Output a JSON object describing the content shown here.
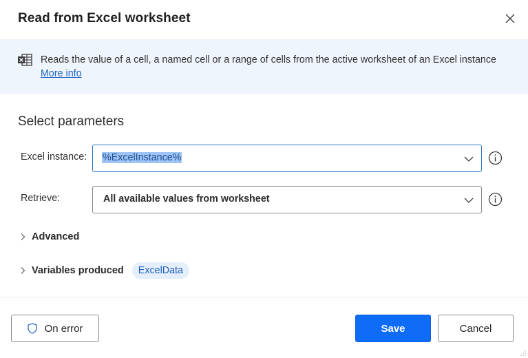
{
  "dialog": {
    "title": "Read from Excel worksheet",
    "close_icon": "close-icon"
  },
  "info": {
    "icon": "excel-icon",
    "description": "Reads the value of a cell, a named cell or a range of cells from the active worksheet of an Excel instance",
    "more_info_label": "More info"
  },
  "parameters": {
    "heading": "Select parameters",
    "fields": [
      {
        "label": "Excel instance:",
        "value": "%ExcelInstance%",
        "text_selected": true,
        "focused": true
      },
      {
        "label": "Retrieve:",
        "value": "All available values from worksheet",
        "text_selected": false,
        "focused": false
      }
    ]
  },
  "expanders": {
    "advanced_label": "Advanced",
    "variables_label": "Variables produced",
    "variables": [
      "ExcelData"
    ]
  },
  "footer": {
    "on_error_label": "On error",
    "save_label": "Save",
    "cancel_label": "Cancel"
  },
  "colors": {
    "primary": "#0f6cf7",
    "banner_bg": "#eff5fc",
    "link": "#1f63c3",
    "chip_bg": "#e5eefb",
    "selection": "#9ec3f5"
  }
}
